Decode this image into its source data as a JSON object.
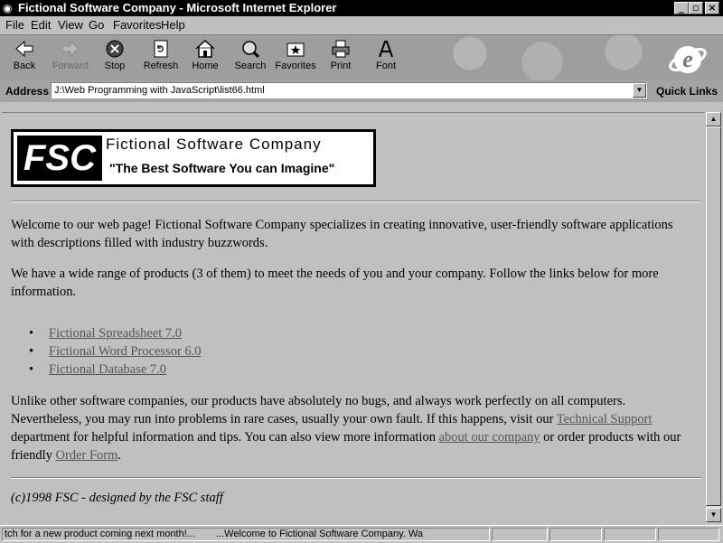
{
  "window": {
    "title": "Fictional Software Company - Microsoft Internet Explorer"
  },
  "menu": {
    "items": [
      {
        "label": "File"
      },
      {
        "label": "Edit"
      },
      {
        "label": "View"
      },
      {
        "label": "Go"
      },
      {
        "label": "Favorites"
      },
      {
        "label": "Help"
      }
    ]
  },
  "toolbar": {
    "back": "Back",
    "forward": "Forward",
    "stop": "Stop",
    "refresh": "Refresh",
    "home": "Home",
    "search": "Search",
    "favorites": "Favorites",
    "print": "Print",
    "font": "Font"
  },
  "address": {
    "label": "Address",
    "value": "J:\\Web Programming with JavaScript\\list66.html",
    "quick_links": "Quick Links"
  },
  "page": {
    "logo_mark": "FSC",
    "logo_name": "Fictional Software Company",
    "logo_tagline": "\"The Best Software You can Imagine\"",
    "intro": "Welcome to our web page! Fictional Software Company specializes in creating innovative, user-friendly software applications with descriptions filled with industry buzzwords.",
    "products_intro": "We have a wide range of products (3 of them) to meet the needs of you and your company. Follow the links below for more information.",
    "products": [
      {
        "label": "Fictional Spreadsheet 7.0"
      },
      {
        "label": "Fictional Word Processor 6.0"
      },
      {
        "label": "Fictional Database 7.0"
      }
    ],
    "support_text_1": "Unlike other software companies, our products have absolutely no bugs, and always work perfectly on all computers. Nevertheless, you may run into problems in rare cases, usually your own fault. If this happens, visit our ",
    "support_link": "Technical Support",
    "support_text_2": " department for helpful information and tips.  You can also view more information ",
    "about_link": "about our company",
    "support_text_3": " or order products with our friendly ",
    "order_link": "Order Form",
    "support_text_4": ".",
    "footer": "(c)1998 FSC - designed by the FSC staff"
  },
  "status": {
    "scroll_text_1": "tch for a new product coming next month!...",
    "scroll_text_2": "...Welcome to Fictional Software Company. Wa"
  }
}
